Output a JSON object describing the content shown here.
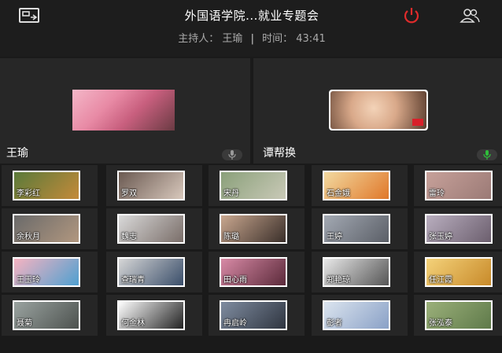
{
  "header": {
    "title": "外国语学院...就业专题会",
    "host_label": "主持人：",
    "host_name": "王瑜",
    "separator": "|",
    "time_label": "时间：",
    "time_value": "43:41",
    "power_color": "#e02b2b"
  },
  "panels": [
    {
      "name": "王瑜",
      "mic_color": "#9a9a9a"
    },
    {
      "name": "谭帮换",
      "mic_color": "#2fbf3a"
    }
  ],
  "participants": [
    {
      "name": "李彩红",
      "colors": [
        "#5a7a3a",
        "#c48a3a"
      ]
    },
    {
      "name": "罗双",
      "colors": [
        "#6b5a52",
        "#d8c8bc"
      ]
    },
    {
      "name": "宋丹",
      "colors": [
        "#8aa07a",
        "#c9c9b7"
      ]
    },
    {
      "name": "石金娥",
      "colors": [
        "#f2d9a0",
        "#e0782a"
      ]
    },
    {
      "name": "雷玲",
      "colors": [
        "#c7a19a",
        "#9b7a76"
      ]
    },
    {
      "name": "余秋月",
      "colors": [
        "#6a6a6a",
        "#b1977f"
      ]
    },
    {
      "name": "魏志",
      "colors": [
        "#d9d9d9",
        "#7a6e69"
      ]
    },
    {
      "name": "陈璐",
      "colors": [
        "#c9a78f",
        "#3a2f2a"
      ]
    },
    {
      "name": "王婷",
      "colors": [
        "#a3a9b3",
        "#5b5f67"
      ]
    },
    {
      "name": "张玉婷",
      "colors": [
        "#b9aebf",
        "#6c5f6e"
      ]
    },
    {
      "name": "王玉玲",
      "colors": [
        "#f6b3c1",
        "#4fa0d0"
      ]
    },
    {
      "name": "查瑞青",
      "colors": [
        "#d6d6d6",
        "#3a4e6a"
      ]
    },
    {
      "name": "田心雨",
      "colors": [
        "#d88aa6",
        "#5b2a3a"
      ]
    },
    {
      "name": "郑艳琼",
      "colors": [
        "#e8e8e8",
        "#555555"
      ]
    },
    {
      "name": "任江霞",
      "colors": [
        "#f4d27a",
        "#c88a2a"
      ]
    },
    {
      "name": "聂菊",
      "colors": [
        "#9aa3a0",
        "#4d524f"
      ]
    },
    {
      "name": "何金林",
      "colors": [
        "#ffffff",
        "#222222"
      ]
    },
    {
      "name": "冉启岭",
      "colors": [
        "#7f8ca0",
        "#2f3540"
      ]
    },
    {
      "name": "彭者",
      "colors": [
        "#dbe4ee",
        "#8aa1c7"
      ]
    },
    {
      "name": "张泓泰",
      "colors": [
        "#9bb07a",
        "#5f7a4a"
      ]
    }
  ]
}
